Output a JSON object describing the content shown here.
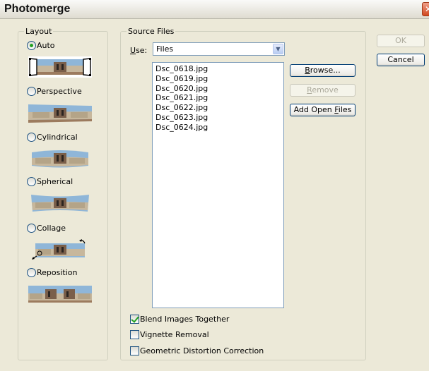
{
  "window": {
    "title": "Photomerge",
    "close_glyph": "✕"
  },
  "layout": {
    "legend": "Layout",
    "options": [
      {
        "label": "Auto",
        "checked": true
      },
      {
        "label": "Perspective",
        "checked": false
      },
      {
        "label": "Cylindrical",
        "checked": false
      },
      {
        "label": "Spherical",
        "checked": false
      },
      {
        "label": "Collage",
        "checked": false
      },
      {
        "label": "Reposition",
        "checked": false
      }
    ]
  },
  "source": {
    "legend": "Source Files",
    "use_label": "Use:",
    "use_value": "Files",
    "files": [
      "Dsc_0618.jpg",
      "Dsc_0619.jpg",
      "Dsc_0620.jpg",
      "Dsc_0621.jpg",
      "Dsc_0622.jpg",
      "Dsc_0623.jpg",
      "Dsc_0624.jpg"
    ],
    "browse_label": "Browse...",
    "remove_label": "Remove",
    "add_open_label": "Add Open Files"
  },
  "options": {
    "blend_label": "Blend Images Together",
    "blend_checked": true,
    "vignette_label": "Vignette Removal",
    "vignette_checked": false,
    "distortion_label": "Geometric Distortion Correction",
    "distortion_checked": false
  },
  "dialog_buttons": {
    "ok_label": "OK",
    "cancel_label": "Cancel"
  },
  "colors": {
    "accent_green": "#21a121",
    "button_border": "#003c74",
    "field_border": "#7f9db9"
  }
}
